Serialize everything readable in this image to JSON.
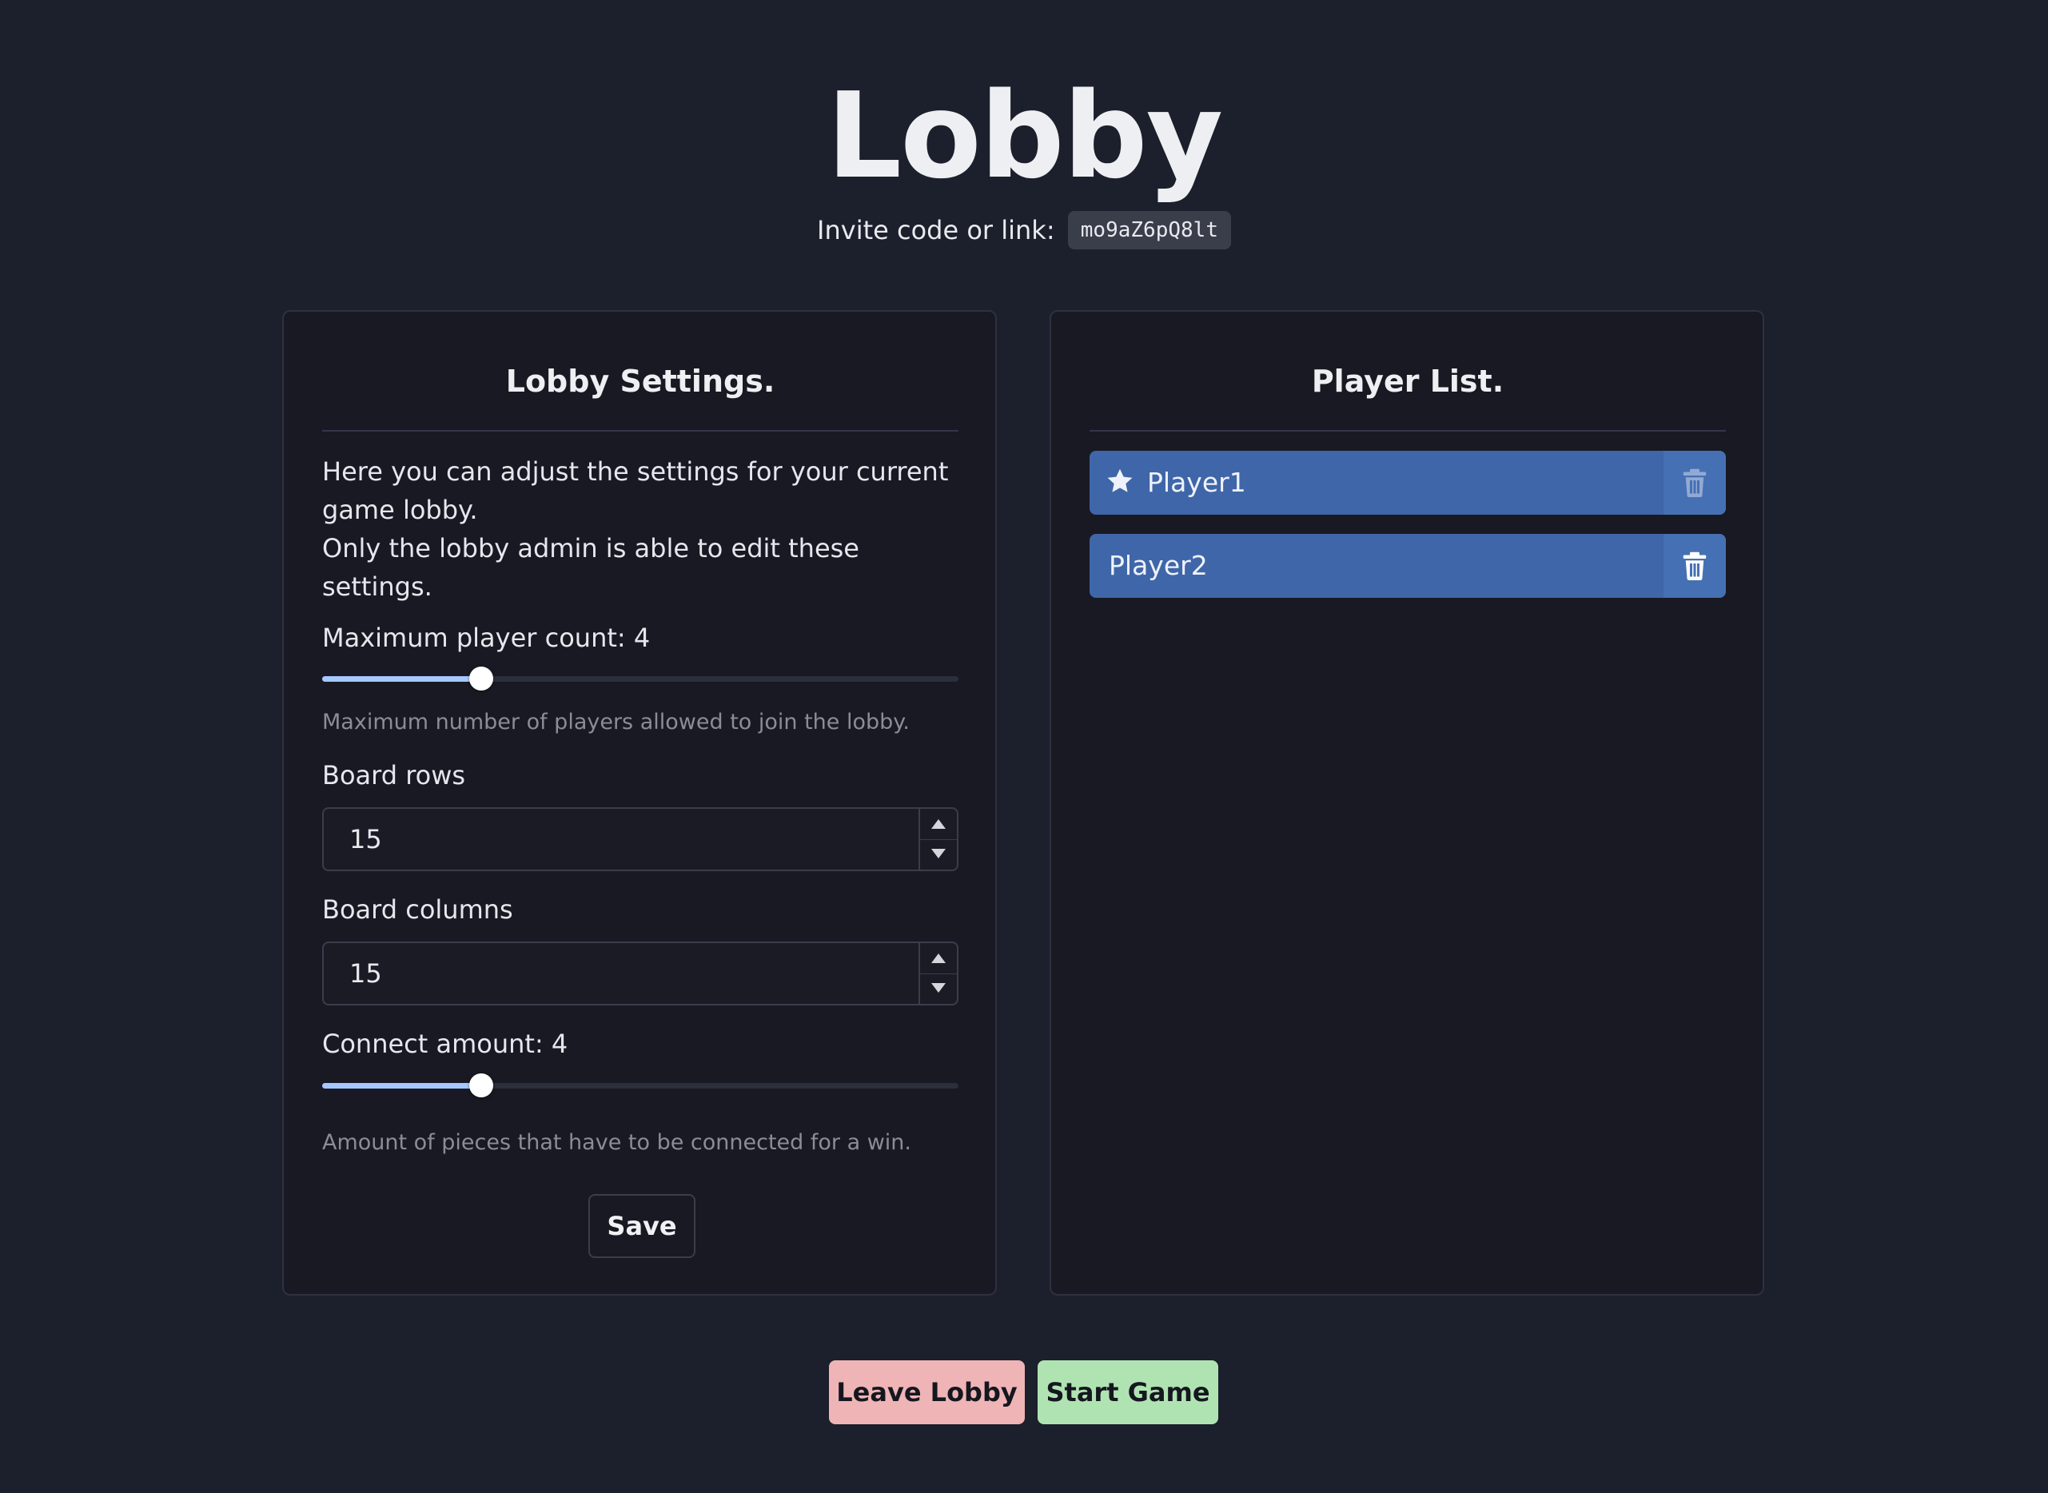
{
  "page": {
    "title": "Lobby",
    "invite_label": "Invite code or link:",
    "invite_code": "mo9aZ6pQ8lt"
  },
  "settings": {
    "title": "Lobby Settings.",
    "description_line1": "Here you can adjust the settings for your current game lobby.",
    "description_line2": "Only the lobby admin is able to edit these settings.",
    "max_players": {
      "label": "Maximum player count: 4",
      "value": 4,
      "fill_fraction": 0.25,
      "helper": "Maximum number of players allowed to join the lobby."
    },
    "board_rows": {
      "label": "Board rows",
      "value": "15"
    },
    "board_columns": {
      "label": "Board columns",
      "value": "15"
    },
    "connect_amount": {
      "label": "Connect amount: 4",
      "value": 4,
      "fill_fraction": 0.25,
      "helper": "Amount of pieces that have to be connected for a win."
    },
    "save_label": "Save"
  },
  "players": {
    "title": "Player List.",
    "items": [
      {
        "name": "Player1",
        "is_admin": true,
        "icon": "star-icon"
      },
      {
        "name": "Player2",
        "is_admin": false
      }
    ]
  },
  "actions": {
    "leave_label": "Leave Lobby",
    "start_label": "Start Game"
  },
  "colors": {
    "background": "#1c1f2c",
    "card": "#181922",
    "player_row": "#3f66a8",
    "slider_fill": "#a7c7ff",
    "leave_button": "#efb4b6",
    "start_button": "#b0e3b2"
  }
}
